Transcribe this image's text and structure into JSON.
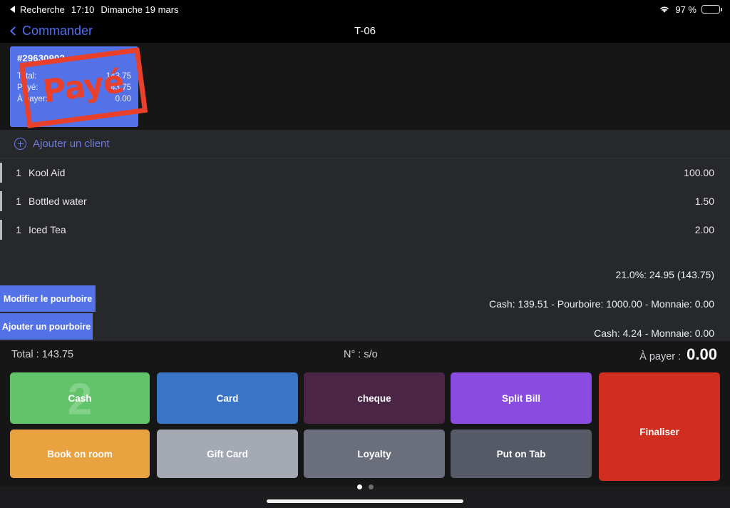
{
  "statusbar": {
    "back_label": "Recherche",
    "time": "17:10",
    "date": "Dimanche 19 mars",
    "battery_percent": "97 %",
    "wifi_icon": "wifi-icon",
    "battery_icon": "battery-icon"
  },
  "navbar": {
    "back_label": "Commander",
    "title": "T-06"
  },
  "order_card": {
    "number": "#29630902",
    "rows": [
      {
        "label": "Total:",
        "value": "143.75"
      },
      {
        "label": "Payé:",
        "value": "143.75"
      },
      {
        "label": "À payer:",
        "value": "0.00"
      }
    ],
    "stamp": "Payé",
    "card_color": "#5472e8",
    "stamp_color": "#e8402a"
  },
  "customer": {
    "add_label": "Ajouter un client",
    "icon": "plus-circle-icon",
    "color": "#6c7ae0"
  },
  "items": [
    {
      "qty": "1",
      "name": "Kool Aid",
      "price": "100.00"
    },
    {
      "qty": "1",
      "name": "Bottled water",
      "price": "1.50"
    },
    {
      "qty": "1",
      "name": "Iced Tea",
      "price": "2.00"
    }
  ],
  "summary": {
    "tax_line": "21.0%: 24.95 (143.75)",
    "payment_line_1": "Cash: 139.51  - Pourboire: 1000.00 - Monnaie: 0.00",
    "payment_line_2": "Cash: 4.24  - Monnaie: 0.00"
  },
  "tip_buttons": {
    "modify": "Modifier le pourboire",
    "add": "Ajouter un pourboire"
  },
  "totals_bar": {
    "total": "Total : 143.75",
    "number": "N° : s/o",
    "due_label": "À payer :",
    "due_value": "0.00"
  },
  "payment_buttons": [
    {
      "label": "Cash",
      "color": "#62c46a",
      "badge": "2"
    },
    {
      "label": "Card",
      "color": "#3a74c4"
    },
    {
      "label": "cheque",
      "color": "#4a2545"
    },
    {
      "label": "Split Bill",
      "color": "#8a4ce0"
    },
    {
      "label": "Finaliser",
      "color": "#cf2e20"
    },
    {
      "label": "Book on room",
      "color": "#e9a23f"
    },
    {
      "label": "Gift Card",
      "color": "#a5a9b4"
    },
    {
      "label": "Loyalty",
      "color": "#6b6f7b"
    },
    {
      "label": "Put on Tab",
      "color": "#555a66"
    }
  ],
  "pagination": {
    "pages": 2,
    "active": 1
  }
}
